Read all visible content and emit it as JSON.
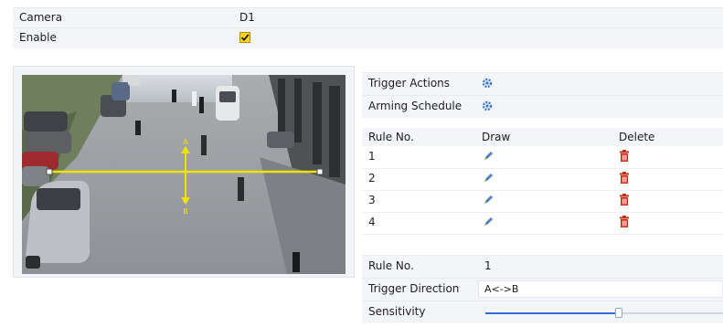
{
  "form": {
    "camera_label": "Camera",
    "camera_value": "D1",
    "enable_label": "Enable",
    "enable_checked": true
  },
  "video": {
    "line_start_label": "A",
    "line_end_label": "B"
  },
  "settings": {
    "trigger_actions_label": "Trigger Actions",
    "arming_schedule_label": "Arming Schedule",
    "gear_icon": "gear-icon"
  },
  "rules_table": {
    "headers": [
      "Rule No.",
      "Draw",
      "Delete"
    ],
    "rows": [
      {
        "no": "1",
        "draw_icon": "pencil-icon",
        "delete_icon": "trash-icon"
      },
      {
        "no": "2",
        "draw_icon": "pencil-icon",
        "delete_icon": "trash-icon"
      },
      {
        "no": "3",
        "draw_icon": "pencil-icon",
        "delete_icon": "trash-icon"
      },
      {
        "no": "4",
        "draw_icon": "pencil-icon",
        "delete_icon": "trash-icon"
      }
    ]
  },
  "rule_detail": {
    "rule_no_label": "Rule No.",
    "rule_no_value": "1",
    "trigger_direction_label": "Trigger Direction",
    "trigger_direction_value": "A<->B",
    "sensitivity_label": "Sensitivity",
    "sensitivity_fraction": 0.56
  },
  "colors": {
    "accent": "#2f6fd6",
    "checkbox": "#ffd51e",
    "line": "#f2e200",
    "delete": "#c5301e"
  }
}
